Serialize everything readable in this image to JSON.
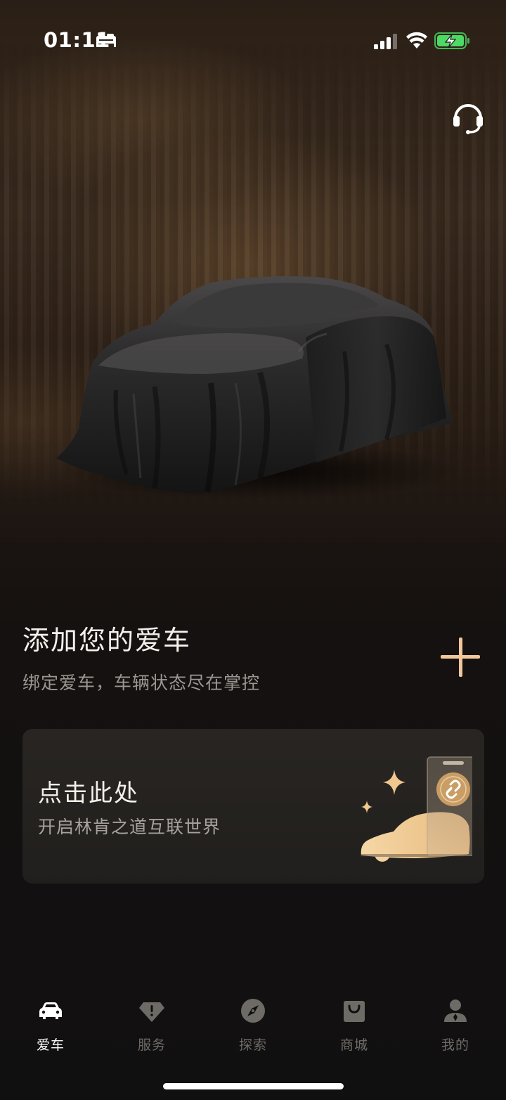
{
  "status_bar": {
    "time": "01:11"
  },
  "header": {
    "support_icon": "headset-icon"
  },
  "add_car": {
    "title": "添加您的爱车",
    "subtitle": "绑定爱车，车辆状态尽在掌控",
    "action_icon": "plus-icon"
  },
  "connect_card": {
    "title": "点击此处",
    "subtitle": "开启林肯之道互联世界"
  },
  "tab_bar": {
    "tabs": [
      {
        "label": "爱车",
        "icon": "car-icon",
        "active": true
      },
      {
        "label": "服务",
        "icon": "diamond-icon",
        "active": false
      },
      {
        "label": "探索",
        "icon": "compass-icon",
        "active": false
      },
      {
        "label": "商城",
        "icon": "shopping-bag-icon",
        "active": false
      },
      {
        "label": "我的",
        "icon": "person-icon",
        "active": false
      }
    ]
  },
  "colors": {
    "accent": "#f2c79a",
    "background": "#111010",
    "card": "#25221f",
    "inactive_tab": "#6e6b67",
    "battery_green": "#4cd964"
  }
}
